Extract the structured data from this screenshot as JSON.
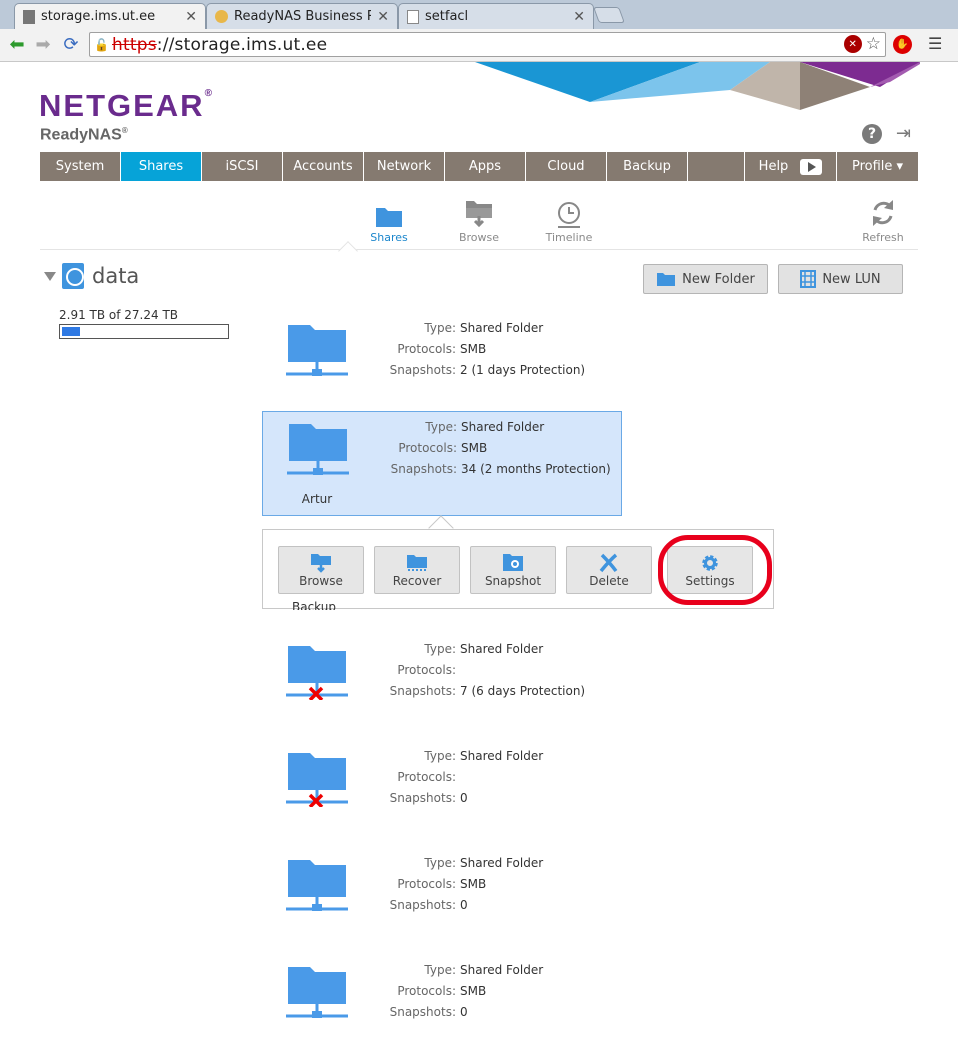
{
  "browser": {
    "tabs": [
      {
        "title": "storage.ims.ut.ee",
        "active": true
      },
      {
        "title": "ReadyNAS Business Rac",
        "active": false
      },
      {
        "title": "setfacl",
        "active": false
      }
    ],
    "url_scheme": "https",
    "url_rest": "://storage.ims.ut.ee"
  },
  "header": {
    "brand": "NETGEAR",
    "product": "ReadyNAS"
  },
  "nav": {
    "items": [
      "System",
      "Shares",
      "iSCSI",
      "Accounts",
      "Network",
      "Apps",
      "Cloud",
      "Backup",
      "",
      "Help",
      "Profile ▾"
    ],
    "active": "Shares"
  },
  "subnav": {
    "items": [
      "Shares",
      "Browse",
      "Timeline"
    ],
    "refresh": "Refresh"
  },
  "volume": {
    "name": "data",
    "capacity_text": "2.91 TB of 27.24 TB",
    "used_fraction": 0.107
  },
  "actions": {
    "new_folder": "New Folder",
    "new_lun": "New LUN"
  },
  "labels": {
    "type": "Type:",
    "protocols": "Protocols:",
    "snapshots": "Snapshots:"
  },
  "shares": [
    {
      "name": "",
      "type": "Shared Folder",
      "protocols": "SMB",
      "snapshots": "2 (1 days Protection)",
      "status": "ok"
    },
    {
      "name": "Artur",
      "type": "Shared Folder",
      "protocols": "SMB",
      "snapshots": "34 (2 months Protection)",
      "status": "ok",
      "selected": true
    },
    {
      "name": "Backup",
      "type": "",
      "protocols": "",
      "snapshots": "",
      "status": "hidden"
    },
    {
      "name": "",
      "type": "Shared Folder",
      "protocols": "",
      "snapshots": "7 (6 days Protection)",
      "status": "offline"
    },
    {
      "name": "",
      "type": "Shared Folder",
      "protocols": "",
      "snapshots": "0",
      "status": "offline"
    },
    {
      "name": "",
      "type": "Shared Folder",
      "protocols": "SMB",
      "snapshots": "0",
      "status": "ok"
    },
    {
      "name": "",
      "type": "Shared Folder",
      "protocols": "SMB",
      "snapshots": "0",
      "status": "ok"
    }
  ],
  "popover": {
    "buttons": [
      "Browse",
      "Recover",
      "Snapshot",
      "Delete",
      "Settings"
    ]
  },
  "colors": {
    "brand_purple": "#6a2b8d",
    "nav_bg": "#857a70",
    "nav_active": "#06a3d8",
    "folder_blue": "#4a9ae8",
    "highlight_red": "#e8001c"
  }
}
